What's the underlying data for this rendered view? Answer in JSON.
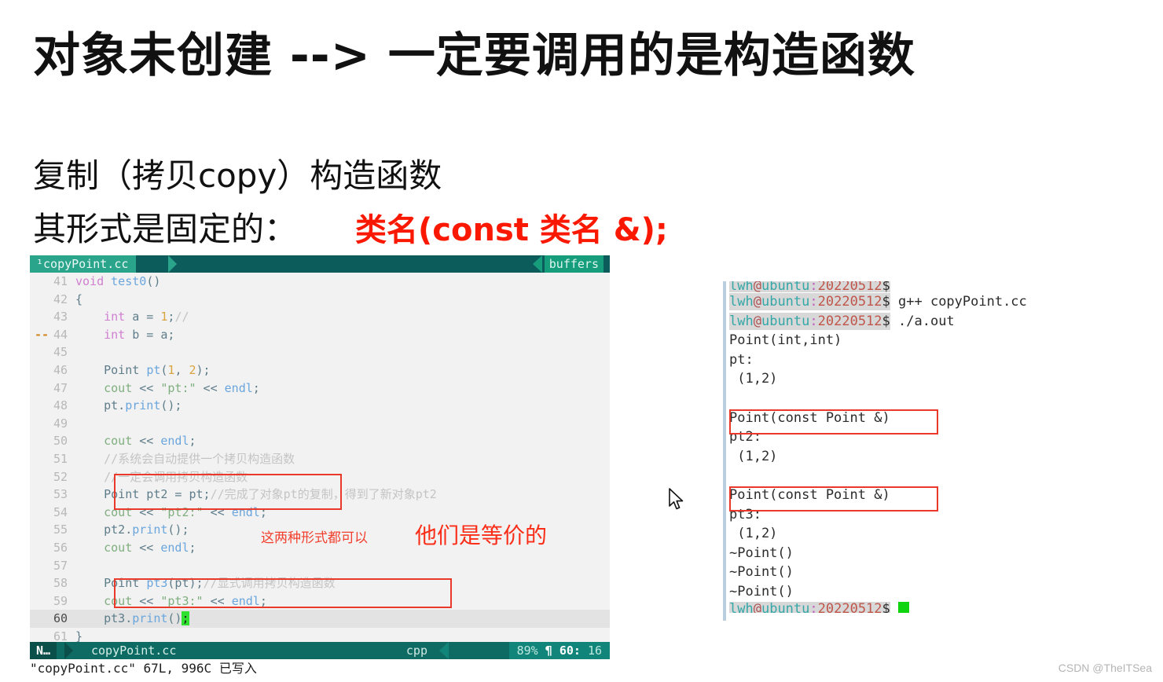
{
  "slide": {
    "title": "对象未创建 --> 一定要调用的是构造函数",
    "subtitle_line1": "复制（拷贝copy）构造函数",
    "subtitle_line2": "其形式是固定的：",
    "formula_red": "类名(const 类名 &);",
    "accent_red": "#fa1800",
    "annotations": {
      "small": "这两种形式都可以",
      "big": "他们是等价的"
    },
    "watermark": "CSDN @TheITSea"
  },
  "editor": {
    "tabline": {
      "active_tab": "¹copyPoint.cc",
      "buffers_label": "buffers"
    },
    "filename": "copyPoint.cc",
    "filetype": "cpp",
    "mode": "N…",
    "percent": "89%",
    "pilcrow": "¶",
    "position": "60:",
    "column": "16",
    "cmdline": "\"copyPoint.cc\" 67L, 996C 已写入",
    "cursor_line": 60,
    "fold_marker_line": 44,
    "fold_marker": "--",
    "lines": [
      {
        "n": "41",
        "segments": [
          {
            "t": "void ",
            "c": "kw"
          },
          {
            "t": "test0",
            "c": "fn"
          },
          {
            "t": "()",
            "c": "op"
          }
        ]
      },
      {
        "n": "42",
        "segments": [
          {
            "t": "{",
            "c": "op"
          }
        ]
      },
      {
        "n": "43",
        "segments": [
          {
            "t": "    ",
            "c": "op"
          },
          {
            "t": "int",
            "c": "kw"
          },
          {
            "t": " a = ",
            "c": "op"
          },
          {
            "t": "1",
            "c": "num"
          },
          {
            "t": ";",
            "c": "op"
          },
          {
            "t": "//",
            "c": "cmt"
          }
        ]
      },
      {
        "n": "44",
        "segments": [
          {
            "t": "    ",
            "c": "op"
          },
          {
            "t": "int",
            "c": "kw"
          },
          {
            "t": " b = a;",
            "c": "op"
          }
        ]
      },
      {
        "n": "45",
        "segments": [
          {
            "t": "",
            "c": "op"
          }
        ]
      },
      {
        "n": "46",
        "segments": [
          {
            "t": "    Point ",
            "c": "typ"
          },
          {
            "t": "pt",
            "c": "idb"
          },
          {
            "t": "(",
            "c": "op"
          },
          {
            "t": "1",
            "c": "num"
          },
          {
            "t": ", ",
            "c": "op"
          },
          {
            "t": "2",
            "c": "num"
          },
          {
            "t": ");",
            "c": "op"
          }
        ]
      },
      {
        "n": "47",
        "segments": [
          {
            "t": "    ",
            "c": "op"
          },
          {
            "t": "cout",
            "c": "str"
          },
          {
            "t": " << ",
            "c": "op"
          },
          {
            "t": "\"pt:\"",
            "c": "str"
          },
          {
            "t": " << ",
            "c": "op"
          },
          {
            "t": "endl",
            "c": "idb"
          },
          {
            "t": ";",
            "c": "op"
          }
        ]
      },
      {
        "n": "48",
        "segments": [
          {
            "t": "    pt.",
            "c": "typ"
          },
          {
            "t": "print",
            "c": "idb"
          },
          {
            "t": "();",
            "c": "op"
          }
        ]
      },
      {
        "n": "49",
        "segments": [
          {
            "t": "",
            "c": "op"
          }
        ]
      },
      {
        "n": "50",
        "segments": [
          {
            "t": "    ",
            "c": "op"
          },
          {
            "t": "cout",
            "c": "str"
          },
          {
            "t": " << ",
            "c": "op"
          },
          {
            "t": "endl",
            "c": "idb"
          },
          {
            "t": ";",
            "c": "op"
          }
        ]
      },
      {
        "n": "51",
        "segments": [
          {
            "t": "    //系统会自动提供一个拷贝构造函数",
            "c": "cmt"
          }
        ]
      },
      {
        "n": "52",
        "segments": [
          {
            "t": "    //一定会调用拷贝构造函数",
            "c": "cmt"
          }
        ]
      },
      {
        "n": "53",
        "segments": [
          {
            "t": "    Point pt2 = pt;",
            "c": "typ"
          },
          {
            "t": "//完成了对象pt的复制，得到了新对象pt2",
            "c": "cmt"
          }
        ]
      },
      {
        "n": "54",
        "segments": [
          {
            "t": "    ",
            "c": "op"
          },
          {
            "t": "cout",
            "c": "str"
          },
          {
            "t": " << ",
            "c": "op"
          },
          {
            "t": "\"pt2:\"",
            "c": "str"
          },
          {
            "t": " << ",
            "c": "op"
          },
          {
            "t": "endl",
            "c": "idb"
          },
          {
            "t": ";",
            "c": "op"
          }
        ]
      },
      {
        "n": "55",
        "segments": [
          {
            "t": "    pt2.",
            "c": "typ"
          },
          {
            "t": "print",
            "c": "idb"
          },
          {
            "t": "();",
            "c": "op"
          }
        ]
      },
      {
        "n": "56",
        "segments": [
          {
            "t": "    ",
            "c": "op"
          },
          {
            "t": "cout",
            "c": "str"
          },
          {
            "t": " << ",
            "c": "op"
          },
          {
            "t": "endl",
            "c": "idb"
          },
          {
            "t": ";",
            "c": "op"
          }
        ]
      },
      {
        "n": "57",
        "segments": [
          {
            "t": "",
            "c": "op"
          }
        ]
      },
      {
        "n": "58",
        "segments": [
          {
            "t": "    Point ",
            "c": "typ"
          },
          {
            "t": "pt3",
            "c": "idb"
          },
          {
            "t": "(pt);",
            "c": "op"
          },
          {
            "t": "//显式调用拷贝构造函数",
            "c": "cmt"
          }
        ]
      },
      {
        "n": "59",
        "segments": [
          {
            "t": "    ",
            "c": "op"
          },
          {
            "t": "cout",
            "c": "str"
          },
          {
            "t": " << ",
            "c": "op"
          },
          {
            "t": "\"pt3:\"",
            "c": "str"
          },
          {
            "t": " << ",
            "c": "op"
          },
          {
            "t": "endl",
            "c": "idb"
          },
          {
            "t": ";",
            "c": "op"
          }
        ]
      },
      {
        "n": "60",
        "segments": [
          {
            "t": "    pt3.",
            "c": "typ"
          },
          {
            "t": "print",
            "c": "idb"
          },
          {
            "t": "()",
            "c": "op"
          },
          {
            "t": ";",
            "c": "cursorchar"
          }
        ]
      },
      {
        "n": "61",
        "segments": [
          {
            "t": "}",
            "c": "op"
          }
        ]
      }
    ]
  },
  "terminal": {
    "prompt": {
      "user": "lwh",
      "at": "@",
      "host": "ubuntu",
      "colon": ":",
      "path": "20220512",
      "dollar": "$"
    },
    "lines": [
      {
        "kind": "prompt",
        "cmd": "",
        "clipped": true
      },
      {
        "kind": "prompt",
        "cmd": " g++ copyPoint.cc"
      },
      {
        "kind": "prompt",
        "cmd": " ./a.out"
      },
      {
        "kind": "out",
        "text": "Point(int,int)"
      },
      {
        "kind": "out",
        "text": "pt:"
      },
      {
        "kind": "out",
        "text": " (1,2)"
      },
      {
        "kind": "out",
        "text": ""
      },
      {
        "kind": "out",
        "text": "Point(const Point &)"
      },
      {
        "kind": "out",
        "text": "pt2:"
      },
      {
        "kind": "out",
        "text": " (1,2)"
      },
      {
        "kind": "out",
        "text": ""
      },
      {
        "kind": "out",
        "text": "Point(const Point &)"
      },
      {
        "kind": "out",
        "text": "pt3:"
      },
      {
        "kind": "out",
        "text": " (1,2)"
      },
      {
        "kind": "out",
        "text": "~Point()"
      },
      {
        "kind": "out",
        "text": "~Point()"
      },
      {
        "kind": "out",
        "text": "~Point()"
      },
      {
        "kind": "prompt",
        "cmd": " ",
        "cursor": true,
        "clipped": true
      }
    ]
  }
}
